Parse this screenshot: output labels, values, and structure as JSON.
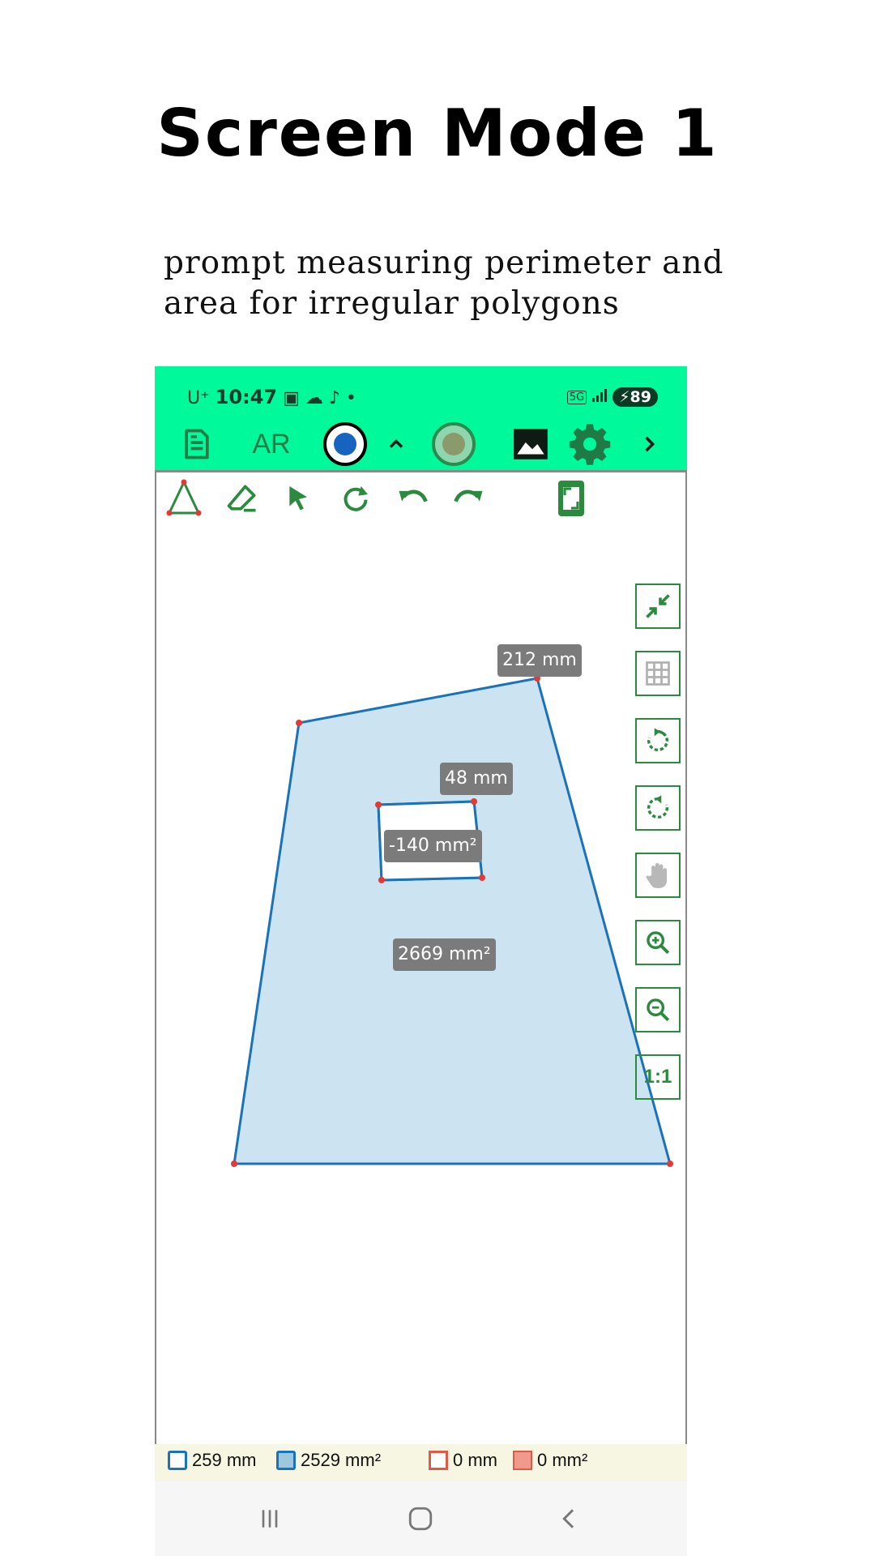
{
  "page": {
    "title": "Screen Mode 1",
    "subtitle": "prompt measuring perimeter and area for irregular polygons"
  },
  "status_bar": {
    "carrier": "U⁺",
    "time": "10:47",
    "network": "5G",
    "battery": "89"
  },
  "top_toolbar": {
    "ar_label": "AR",
    "accent_color": "#00f99a",
    "icons": [
      "document-icon",
      "ar-mode",
      "record-color-icon",
      "chevron-up-icon",
      "fill-color-icon",
      "image-icon",
      "gear-icon",
      "chevron-right-icon"
    ]
  },
  "drawing_tools": [
    "polygon-tool-icon",
    "eraser-icon",
    "select-pointer-icon",
    "rotate-icon",
    "undo-icon",
    "redo-icon",
    "fit-screen-icon"
  ],
  "side_tools": [
    "collapse-icon",
    "grid-icon",
    "rotate-cw-icon",
    "rotate-ccw-icon",
    "pan-hand-icon",
    "zoom-in-icon",
    "zoom-out-icon",
    "one-to-one-label"
  ],
  "side_one_to_one": "1:1",
  "shapes": {
    "outer_edge_label": "212 mm",
    "inner_edge_label": "48 mm",
    "inner_area_label": "-140 mm²",
    "outer_area_label": "2669 mm²",
    "stroke_color": "#1a73b9",
    "fill_color": "#cce3f1",
    "vertex_color": "#e53935"
  },
  "legend": {
    "perimeter_blue": "259 mm",
    "area_blue": "2529 mm²",
    "perimeter_red": "0 mm",
    "area_red": "0 mm²"
  }
}
